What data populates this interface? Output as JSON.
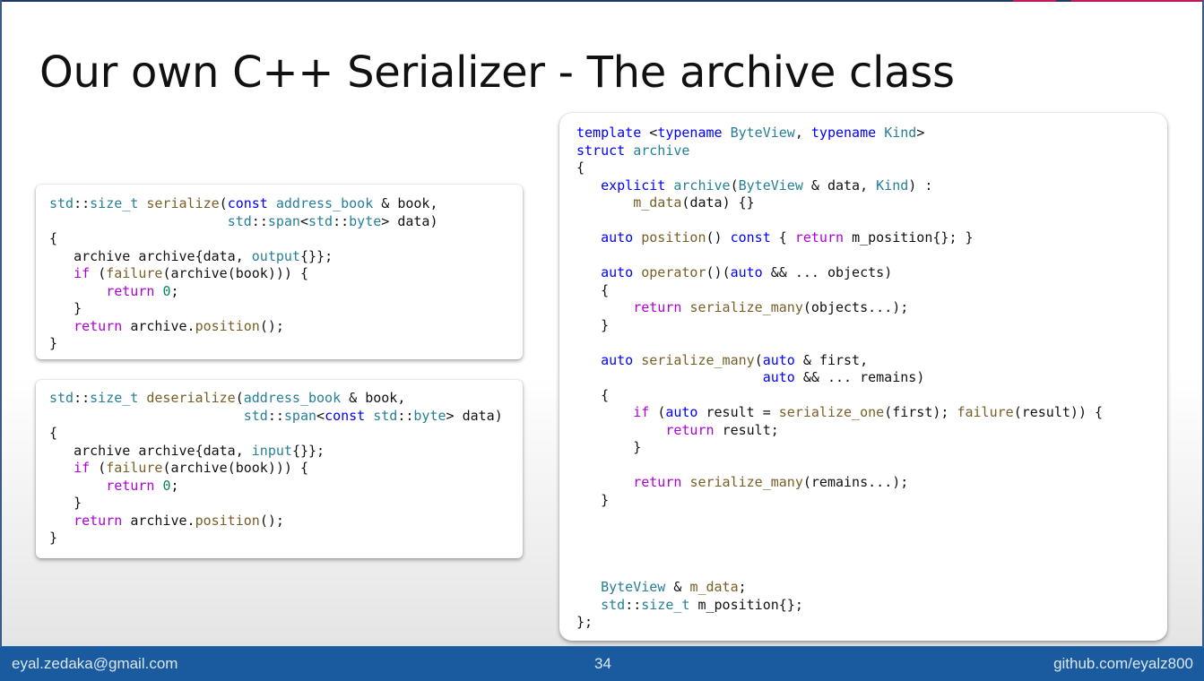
{
  "slide": {
    "title": "Our own C++ Serializer - The archive class",
    "colors": {
      "footer_background": "#1a5a9e",
      "footer_text": "#dbe6f2",
      "top_accent": "#c2185b",
      "keyword": "#0000ff",
      "type": "#267f99",
      "function": "#795e26",
      "control": "#af00db",
      "number": "#098658"
    }
  },
  "code": {
    "serialize": [
      "std::size_t serialize(const address_book & book,",
      "                      std::span<std::byte> data)",
      "{",
      "   archive archive{data, output{}};",
      "   if (failure(archive(book))) {",
      "       return 0;",
      "   }",
      "   return archive.position();",
      "}"
    ],
    "deserialize": [
      "std::size_t deserialize(address_book & book,",
      "                        std::span<const std::byte> data)",
      "{",
      "   archive archive{data, input{}};",
      "   if (failure(archive(book))) {",
      "       return 0;",
      "   }",
      "   return archive.position();",
      "}"
    ],
    "archive": [
      "template <typename ByteView, typename Kind>",
      "struct archive",
      "{",
      "   explicit archive(ByteView & data, Kind) :",
      "       m_data(data) {}",
      "",
      "   auto position() const { return m_position{}; }",
      "",
      "   auto operator()(auto && ... objects)",
      "   {",
      "       return serialize_many(objects...);",
      "   }",
      "",
      "   auto serialize_many(auto & first,",
      "                       auto && ... remains)",
      "   {",
      "       if (auto result = serialize_one(first); failure(result)) {",
      "           return result;",
      "       }",
      "",
      "       return serialize_many(remains...);",
      "   }",
      "",
      "",
      "",
      "",
      "   ByteView & m_data;",
      "   std::size_t m_position{};",
      "};"
    ]
  },
  "footer": {
    "email": "eyal.zedaka@gmail.com",
    "page_number": "34",
    "github": "github.com/eyalz800"
  }
}
